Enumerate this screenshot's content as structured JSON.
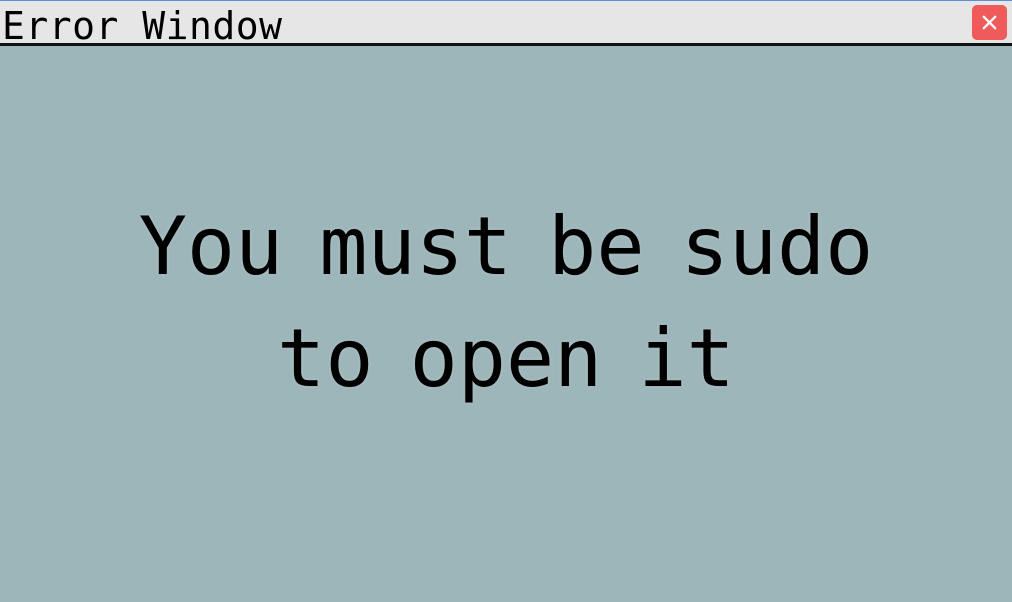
{
  "window": {
    "title": "Error Window",
    "close_icon": "close-icon",
    "accent_close": "#ef5a5a",
    "background": "#9db6ba",
    "titlebar_background": "#e6e6e6"
  },
  "content": {
    "message": "You must be sudo to open it"
  }
}
